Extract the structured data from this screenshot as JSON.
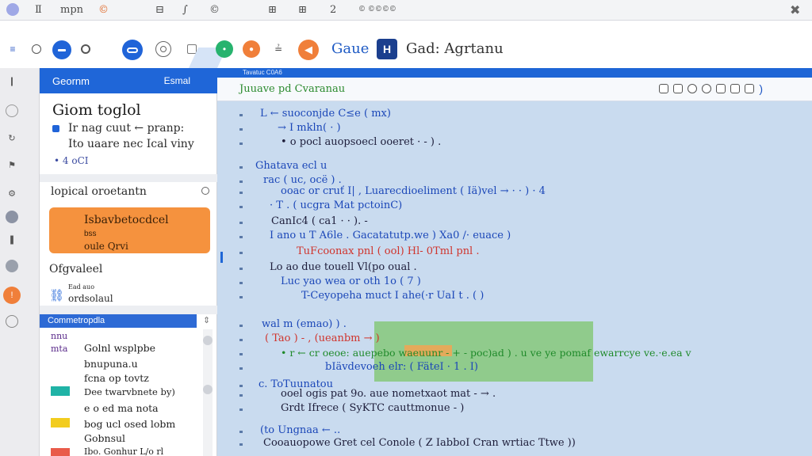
{
  "menubar": {
    "items": [
      "Ⅱ",
      "mpn",
      "©",
      "⊟",
      "∫",
      "©",
      "⊞",
      "⊞",
      "2",
      "© ©©©©"
    ],
    "close": "✖"
  },
  "toolbar": {
    "label_1": "Gaue",
    "label_2": "Gad: Agrtanu",
    "badge": "H"
  },
  "bluestrip": {
    "text": "Tavatuc C0A6"
  },
  "editor": {
    "header_title": "Juuave pd Cvaranau",
    "lines": [
      {
        "text": "L  ← suoconjde  C≤e ( mx)",
        "class": "c-blue"
      },
      {
        "text": "→  I mkln(  ·   )",
        "class": "c-blue"
      },
      {
        "text": "•  o pocl auopsoecl ooeret · - ) .",
        "class": "c-dark"
      },
      {
        "text": "Ghatava ecl u",
        "class": "c-blue"
      },
      {
        "text": "rac  ( uc, ocë  ) .",
        "class": "c-blue"
      },
      {
        "text": "ooac or cruť I| , Luarecdioeliment  ( Iä)vel  → · ·   )  ·   4",
        "class": "c-blue"
      },
      {
        "text": "· T .  ( ucgra Mat pctoinC)",
        "class": "c-blue"
      },
      {
        "text": "CanIc4 ( ca1  ·  · ). -",
        "class": "c-dark"
      },
      {
        "text": "I ano u T A6le . Gacatatutp.we )  Xa0 /·   euace )",
        "class": "c-blue"
      },
      {
        "text": "TuFcoonax pnl ( ool) Hl- 0Tml pnl .",
        "class": "c-red"
      },
      {
        "text": "Lo  ao due touell  Vl(po oual .",
        "class": "c-dark"
      },
      {
        "text": "Luc yao wea or oth 1o ( 7 )",
        "class": "c-blue"
      },
      {
        "text": "T-Ceyopeha muct  I ahe(·r UaI t . ( )",
        "class": "c-blue"
      },
      {
        "text": "wal m (emao) ) .",
        "class": "c-blue"
      },
      {
        "text": "( Tao ) - , (ueanbm → )",
        "class": "c-red"
      },
      {
        "text": "• r ← cr oeoe: auepebo waeuunr - + - poc)ad ) .  u ve ye pomaf ewarrcye ve.·e.ea v",
        "class": "c-green"
      },
      {
        "text": "bIävdevoeh elr: ( FäteI · 1 .  I)",
        "class": "c-blue"
      },
      {
        "text": "c. ToTuunatou",
        "class": "c-blue"
      },
      {
        "text": "ooel ogis pat 9o. aue nometxaot mat - → .",
        "class": "c-dark"
      },
      {
        "text": "Grdt  Ifrece ( SyKTC cauttmonue  - )",
        "class": "c-dark"
      },
      {
        "text": "(to Ungnaa ← ..",
        "class": "c-blue"
      },
      {
        "text": "Cooauopowe Gret  cel Conole ( Z IabboI Cran wrtiac Ttwe ))",
        "class": "c-dark"
      }
    ]
  },
  "panel": {
    "header_left": "Geornm",
    "header_right": "Esmal",
    "heading": "Giom toglol",
    "desc_1": "Ir nag cuut ← pranp:",
    "desc_2": "Ito uaare nec Ical viny",
    "meta": "• 4 oCI",
    "section_title": "lopical oroetantn",
    "card_a": "Isbavbetocdcel",
    "card_b": "bss",
    "card_c": "oule Qrvi",
    "sub_title": "Ofgvaleel",
    "sub_a": "Ead auo",
    "sub_b": "ordsolaul",
    "list_head": "Commetropdla",
    "list": [
      {
        "label_left": "nnu",
        "text": "Golnl  wsplpbe"
      },
      {
        "label_left": "mta",
        "text": "bnupuna.u"
      },
      {
        "label_left": "",
        "text": "fcna op tovtz"
      },
      {
        "label_left": "",
        "text": "Dee twarvbnete by)"
      },
      {
        "label_left": "",
        "text": "e o ed ma nota"
      },
      {
        "label_left": "",
        "text": "bog ucl osed lobm"
      },
      {
        "label_left": "",
        "text": "Gobnsul"
      },
      {
        "label_left": "",
        "text": "Ibo. Gonhur L/o rl"
      }
    ]
  },
  "colors": {
    "accent_blue": "#1f66d8",
    "editor_bg": "#c9dbef",
    "card_orange": "#f5923e",
    "swatch_teal": "#20b3a6",
    "swatch_yellow": "#f2cc1e",
    "swatch_red": "#e95b4a"
  }
}
